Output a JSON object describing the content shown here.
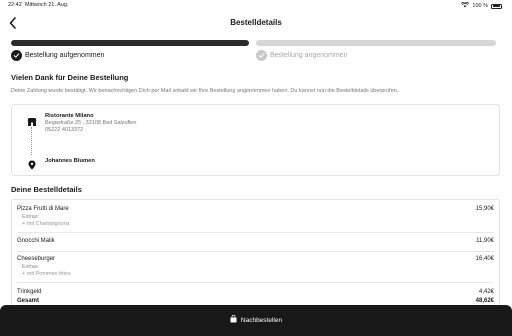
{
  "status_bar": {
    "time": "22:42",
    "date": "Mittwoch 21. Aug.",
    "battery": "100 %"
  },
  "nav": {
    "title": "Bestelldetails"
  },
  "progress": {
    "steps": [
      {
        "label": "Bestellung aufgenommen",
        "done": true
      },
      {
        "label": "Bestellung angenommen",
        "done": false
      }
    ]
  },
  "confirmation": {
    "title": "Vielen Dank für Deine Bestellung",
    "text": "Deine Zahlung wurde bestätigt. Wir benachrichtigen Dich per Mail sobald wir Ihre Bestellung angenommen haben. Du kannst nun die Bestelldetails überprüfen."
  },
  "restaurant": {
    "name": "Ristorante Milano",
    "street": "Begastraße 25 , 32108 Bad Salzuflen",
    "phone": "05222 4013372"
  },
  "customer": {
    "name": "Johannes Blumen"
  },
  "order": {
    "title": "Deine Bestelldetails",
    "items": [
      {
        "name": "Pizza Frutti di Mare",
        "price": "15,90€",
        "extras_label": "Extras:",
        "extra": "+ mit Champignons"
      },
      {
        "name": "Gnocchi Malik",
        "price": "11,90€"
      },
      {
        "name": "Cheeseburger",
        "price": "16,40€",
        "extras_label": "Extras:",
        "extra": "+ mit Pommes frites"
      }
    ],
    "tip_label": "Trinkgeld",
    "tip_value": "4,42€",
    "total_label": "Gesamt",
    "total_value": "48,62€"
  },
  "footer": {
    "reorder_label": "Nachbestellen"
  },
  "colors": {
    "accent": "#1a1a1a",
    "inactive": "#d6d6d6"
  }
}
